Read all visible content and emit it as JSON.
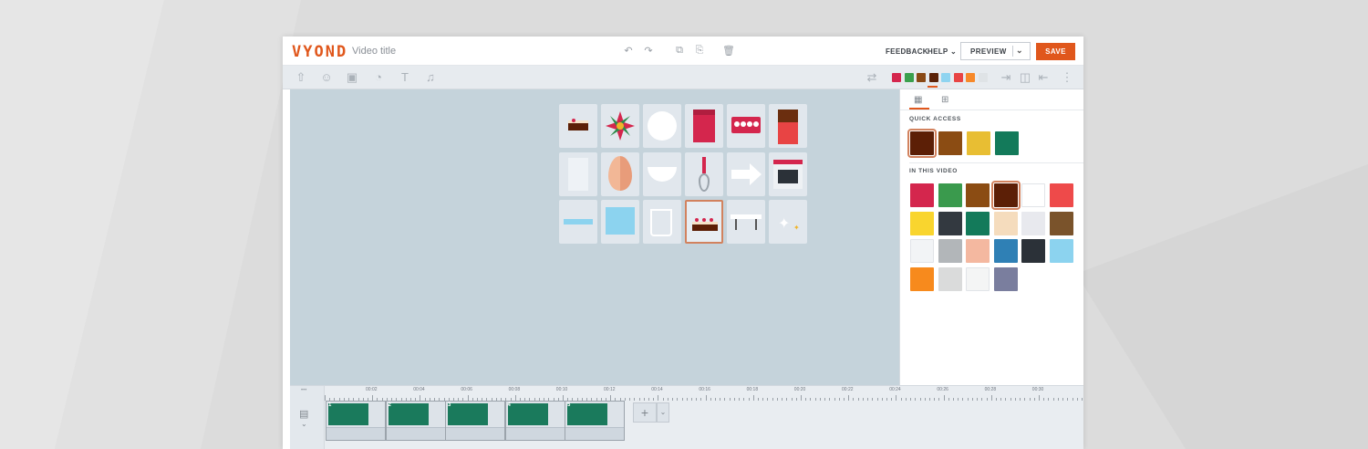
{
  "header": {
    "logo": "VYOND",
    "video_title": "Video title",
    "feedback": "FEEDBACK",
    "help": "HELP",
    "preview": "PREVIEW",
    "save": "SAVE"
  },
  "toolbar": {
    "palette": [
      "#d4264d",
      "#3aa04d",
      "#8a4a16",
      "#5a2208",
      "#8fd4f0",
      "#e84444",
      "#f7892a",
      "#dfe3e6"
    ]
  },
  "panel": {
    "quick_access_label": "QUICK ACCESS",
    "in_this_video_label": "IN THIS VIDEO",
    "quick_access": [
      "#5c1f06",
      "#8b4c13",
      "#e8be33",
      "#137a5a"
    ],
    "in_this_video": [
      "#d4264d",
      "#3a9a4d",
      "#8b4c13",
      "#5c1f06",
      "#ffffff",
      "#ee4a4a",
      "#f9d52e",
      "#333940",
      "#137a5a",
      "#f5dcbd",
      "#e8e9ee",
      "#7a532b",
      "#f2f4f6",
      "#b2b6b9",
      "#f4b8a0",
      "#2f80b5",
      "#2b3138",
      "#8cd3ef",
      "#f78a1d",
      "#dadbdb",
      "#f4f5f5",
      "#7a7e9e"
    ]
  },
  "timeline": {
    "ticks": [
      "00:02",
      "00:04",
      "00:06",
      "00:08",
      "00:10",
      "00:12",
      "00:14",
      "00:16",
      "00:18",
      "00:20",
      "00:22",
      "00:24",
      "00:26",
      "00:28",
      "00:30"
    ],
    "scenes": [
      "1",
      "2",
      "3",
      "4",
      "5"
    ]
  }
}
